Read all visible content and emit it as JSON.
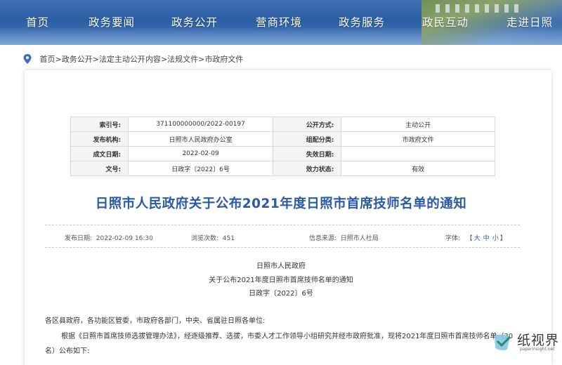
{
  "nav": {
    "items": [
      "首页",
      "政务要闻",
      "政务公开",
      "营商环境",
      "政务服务",
      "政民互动",
      "走进日照"
    ]
  },
  "breadcrumb": {
    "items": [
      "首页",
      "政务公开",
      "法定主动公开内容",
      "法规文件",
      "市政府文件"
    ],
    "separator": ">"
  },
  "info_table": {
    "rows": [
      {
        "label1": "索引号:",
        "value1": "371100000000/2022-00197",
        "label2": "公开方式:",
        "value2": "主动公开"
      },
      {
        "label1": "发布机构:",
        "value1": "日照市人民政府办公室",
        "label2": "组配分类:",
        "value2": "市政府文件"
      },
      {
        "label1": "成文日期:",
        "value1": "2022-02-09",
        "label2": "失效日期:",
        "value2": ""
      },
      {
        "label1": "文号:",
        "value1": "日政字〔2022〕6号",
        "label2": "效力状态:",
        "value2": "有效"
      }
    ]
  },
  "article": {
    "title": "日照市人民政府关于公布2021年度日照市首席技师名单的通知",
    "publish_date_label": "发布日期:",
    "publish_date": "2022-02-09 16:30",
    "views_label": "浏览次数:",
    "views": "451",
    "source_label": "信息来源:",
    "source": "日照市人社局",
    "font_label": "字体:",
    "font_open": "【",
    "font_large": "大",
    "font_medium": "中",
    "font_small": "小",
    "font_close": "】",
    "doc_head": [
      "日照市人民政府",
      "关于公布2021年度日照市首席技师名单的通知",
      "日政字〔2022〕6号"
    ],
    "salutation": "各区县政府，各功能区管委，市政府各部门，中央、省属驻日照各单位:",
    "body1": "根据《日照市首席技师选拔管理办法》，经逐级推荐、选拔，市委人才工作领导小组研究并经市政府批准，现将2021年度日照市首席技师名单（30",
    "body2": "名）公布如下:"
  },
  "watermark": {
    "name": "纸视界",
    "url": "paperinsight.net"
  },
  "colors": {
    "accent": "#2a5aa6",
    "nav_bg": "#2b5da4",
    "pin": "#3a6fc4"
  }
}
